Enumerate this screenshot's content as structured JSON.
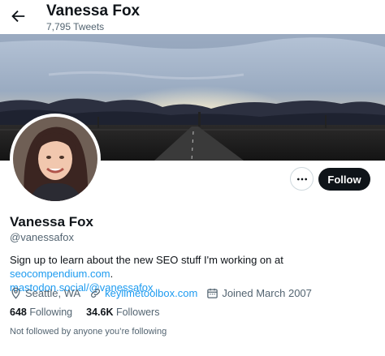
{
  "header": {
    "back_icon": "arrow-left-icon",
    "name": "Vanessa Fox",
    "tweets": "7,795 Tweets"
  },
  "banner": {
    "description_icon": "sunset-road-landscape"
  },
  "profile": {
    "avatar_icon": "profile-photo",
    "more_icon": "ellipsis-icon",
    "follow_label": "Follow",
    "display_name": "Vanessa Fox",
    "handle": "@vanessafox",
    "bio_text": "Sign up to learn about the new SEO stuff I'm working on at ",
    "bio_link1": "seocompendium.com",
    "bio_sep": ".",
    "bio_link2": "mastodon.social/@vanessafox",
    "location_icon": "location-pin-icon",
    "location": "Seattle, WA",
    "website_icon": "link-icon",
    "website": "keylimetoolbox.com",
    "joined_icon": "calendar-icon",
    "joined": "Joined March 2007",
    "following_count": "648",
    "following_label": " Following",
    "followers_count": "34.6K",
    "followers_label": " Followers",
    "not_followed": "Not followed by anyone you’re following"
  },
  "colors": {
    "accent": "#1d9bf0",
    "text": "#0f1419",
    "secondary": "#536471",
    "button": "#0f1419"
  }
}
